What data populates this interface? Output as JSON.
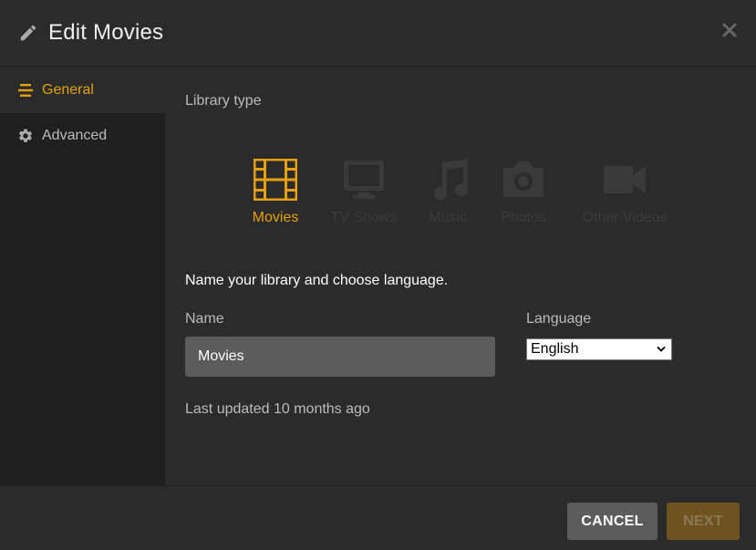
{
  "header": {
    "title": "Edit Movies",
    "edit_icon": "pencil-icon",
    "close_icon": "close-icon"
  },
  "sidebar": {
    "items": [
      {
        "label": "General",
        "icon": "list-icon",
        "active": true
      },
      {
        "label": "Advanced",
        "icon": "gear-icon",
        "active": false
      }
    ]
  },
  "main": {
    "library_type_label": "Library type",
    "library_types": [
      {
        "label": "Movies",
        "icon": "film-icon",
        "active": true
      },
      {
        "label": "TV Shows",
        "icon": "tv-icon",
        "active": false
      },
      {
        "label": "Music",
        "icon": "music-note-icon",
        "active": false
      },
      {
        "label": "Photos",
        "icon": "camera-icon",
        "active": false
      },
      {
        "label": "Other Videos",
        "icon": "video-camera-icon",
        "active": false
      }
    ],
    "heading": "Name your library and choose language.",
    "name_label": "Name",
    "name_value": "Movies",
    "language_label": "Language",
    "language_value": "English",
    "last_updated": "Last updated 10 months ago"
  },
  "footer": {
    "cancel_label": "CANCEL",
    "next_label": "NEXT"
  },
  "colors": {
    "accent": "#e5a00d",
    "background": "#2b2b2b",
    "sidebar": "#1f1f1f",
    "input": "#5c5c5c"
  }
}
